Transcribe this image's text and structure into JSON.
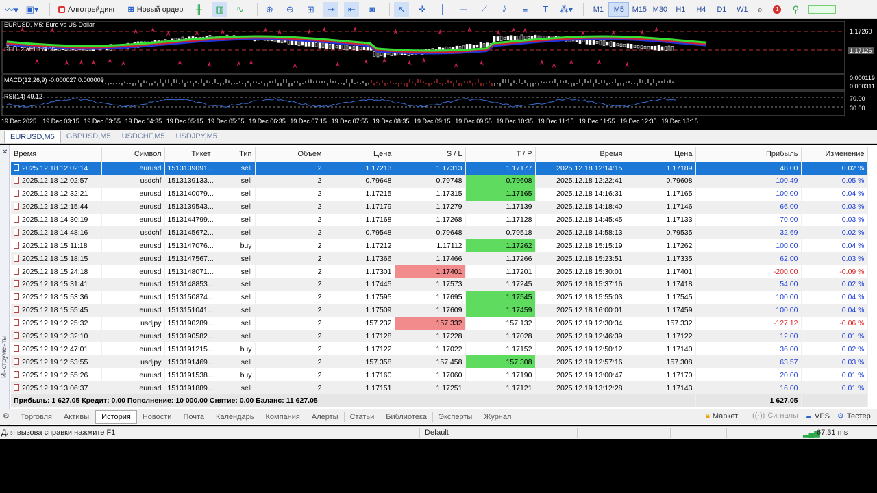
{
  "toolbar": {
    "algo_label": "Алготрейдинг",
    "new_order_label": "Новый ордер",
    "timeframes": [
      "M1",
      "M5",
      "M15",
      "M30",
      "H1",
      "H4",
      "D1",
      "W1"
    ],
    "active_timeframe": "M5",
    "notification_count": "1"
  },
  "chart": {
    "title": "EURUSD, M5:  Euro vs US Dollar",
    "sell_label": "SELL 2 at 1.17106",
    "price_top": "1.17260",
    "price_cur": "1.17126",
    "macd_label": "MACD(12,26,9) -0.000027 0.000009",
    "macd_v1": "0.000119",
    "macd_v2": "0.000311",
    "rsi_label": "RSI(14) 49.12",
    "rsi_v1": "70.00",
    "rsi_v2": "30.00",
    "time_labels": [
      "19 Dec 2025",
      "19 Dec 03:15",
      "19 Dec 03:55",
      "19 Dec 04:35",
      "19 Dec 05:15",
      "19 Dec 05:55",
      "19 Dec 06:35",
      "19 Dec 07:15",
      "19 Dec 07:55",
      "19 Dec 08:35",
      "19 Dec 09:15",
      "19 Dec 09:55",
      "19 Dec 10:35",
      "19 Dec 11:15",
      "19 Dec 11:55",
      "19 Dec 12:35",
      "19 Dec 13:15"
    ]
  },
  "chart_tabs": [
    "EURUSD,M5",
    "GBPUSD,M5",
    "USDCHF,M5",
    "USDJPY,M5"
  ],
  "terminal": {
    "side_label": "Инструменты",
    "columns": [
      "Время",
      "Символ",
      "Тикет",
      "Тип",
      "Объем",
      "Цена",
      "S / L",
      "T / P",
      "Время",
      "Цена",
      "Прибыль",
      "Изменение"
    ],
    "rows": [
      [
        "2025.12.18 12:02:14",
        "eurusd",
        "1513139091...",
        "sell",
        "2",
        "1.17213",
        "1.17313",
        "1.17177",
        "2025.12.18 12:14:15",
        "1.17189",
        "48.00",
        "0.02 %"
      ],
      [
        "2025.12.18 12:02:57",
        "usdchf",
        "1513139133...",
        "sell",
        "2",
        "0.79648",
        "0.79748",
        "0.79608",
        "2025.12.18 12:22:41",
        "0.79608",
        "100.49",
        "0.05 %"
      ],
      [
        "2025.12.18 12:32:21",
        "eurusd",
        "1513140079...",
        "sell",
        "2",
        "1.17215",
        "1.17315",
        "1.17165",
        "2025.12.18 14:16:31",
        "1.17165",
        "100.00",
        "0.04 %"
      ],
      [
        "2025.12.18 12:15:44",
        "eurusd",
        "1513139543...",
        "sell",
        "2",
        "1.17179",
        "1.17279",
        "1.17139",
        "2025.12.18 14:18:40",
        "1.17146",
        "66.00",
        "0.03 %"
      ],
      [
        "2025.12.18 14:30:19",
        "eurusd",
        "1513144799...",
        "sell",
        "2",
        "1.17168",
        "1.17268",
        "1.17128",
        "2025.12.18 14:45:45",
        "1.17133",
        "70.00",
        "0.03 %"
      ],
      [
        "2025.12.18 14:48:16",
        "usdchf",
        "1513145672...",
        "sell",
        "2",
        "0.79548",
        "0.79648",
        "0.79518",
        "2025.12.18 14:58:13",
        "0.79535",
        "32.69",
        "0.02 %"
      ],
      [
        "2025.12.18 15:11:18",
        "eurusd",
        "1513147076...",
        "buy",
        "2",
        "1.17212",
        "1.17112",
        "1.17262",
        "2025.12.18 15:15:19",
        "1.17262",
        "100.00",
        "0.04 %"
      ],
      [
        "2025.12.18 15:18:15",
        "eurusd",
        "1513147567...",
        "sell",
        "2",
        "1.17366",
        "1.17466",
        "1.17266",
        "2025.12.18 15:23:51",
        "1.17335",
        "62.00",
        "0.03 %"
      ],
      [
        "2025.12.18 15:24:18",
        "eurusd",
        "1513148071...",
        "sell",
        "2",
        "1.17301",
        "1.17401",
        "1.17201",
        "2025.12.18 15:30:01",
        "1.17401",
        "-200.00",
        "-0.09 %"
      ],
      [
        "2025.12.18 15:31:41",
        "eurusd",
        "1513148853...",
        "sell",
        "2",
        "1.17445",
        "1.17573",
        "1.17245",
        "2025.12.18 15:37:16",
        "1.17418",
        "54.00",
        "0.02 %"
      ],
      [
        "2025.12.18 15:53:36",
        "eurusd",
        "1513150874...",
        "sell",
        "2",
        "1.17595",
        "1.17695",
        "1.17545",
        "2025.12.18 15:55:03",
        "1.17545",
        "100.00",
        "0.04 %"
      ],
      [
        "2025.12.18 15:55:45",
        "eurusd",
        "1513151041...",
        "sell",
        "2",
        "1.17509",
        "1.17609",
        "1.17459",
        "2025.12.18 16:00:01",
        "1.17459",
        "100.00",
        "0.04 %"
      ],
      [
        "2025.12.19 12:25:32",
        "usdjpy",
        "1513190289...",
        "sell",
        "2",
        "157.232",
        "157.332",
        "157.132",
        "2025.12.19 12:30:34",
        "157.332",
        "-127.12",
        "-0.06 %"
      ],
      [
        "2025.12.19 12:32:10",
        "eurusd",
        "1513190582...",
        "sell",
        "2",
        "1.17128",
        "1.17228",
        "1.17028",
        "2025.12.19 12:46:39",
        "1.17122",
        "12.00",
        "0.01 %"
      ],
      [
        "2025.12.19 12:47:01",
        "eurusd",
        "1513191215...",
        "buy",
        "2",
        "1.17122",
        "1.17022",
        "1.17152",
        "2025.12.19 12:50:12",
        "1.17140",
        "36.00",
        "0.02 %"
      ],
      [
        "2025.12.19 12:53:55",
        "usdjpy",
        "1513191469...",
        "sell",
        "2",
        "157.358",
        "157.458",
        "157.308",
        "2025.12.19 12:57:16",
        "157.308",
        "63.57",
        "0.03 %"
      ],
      [
        "2025.12.19 12:55:26",
        "eurusd",
        "1513191538...",
        "buy",
        "2",
        "1.17160",
        "1.17060",
        "1.17190",
        "2025.12.19 13:00:47",
        "1.17170",
        "20.00",
        "0.01 %"
      ],
      [
        "2025.12.19 13:06:37",
        "eurusd",
        "1513191889...",
        "sell",
        "2",
        "1.17151",
        "1.17251",
        "1.17121",
        "2025.12.19 13:12:28",
        "1.17143",
        "16.00",
        "0.01 %"
      ]
    ],
    "sl_hit_rows": [
      8,
      12
    ],
    "tp_hit_rows": [
      1,
      2,
      6,
      10,
      11,
      15
    ],
    "summary": "Прибыль: 1 627.05  Кредит: 0.00  Пополнение: 10 000.00  Снятие: 0.00  Баланс: 11 627.05",
    "summary_total": "1 627.05"
  },
  "bottom_tabs": [
    "Торговля",
    "Активы",
    "История",
    "Новости",
    "Почта",
    "Календарь",
    "Компания",
    "Алерты",
    "Статьи",
    "Библиотека",
    "Эксперты",
    "Журнал"
  ],
  "active_bottom_tab": "История",
  "bottom_right": {
    "market": "Маркет",
    "signals": "Сигналы",
    "vps": "VPS",
    "tester": "Тестер"
  },
  "status": {
    "help": "Для вызова справки нажмите F1",
    "profile": "Default",
    "ping": "67.31 ms"
  },
  "colors": {
    "selected_row": "#1c78d7",
    "sl_hit": "#f28c8c",
    "tp_hit": "#5fdb5f",
    "profit_positive": "#1f3fd6",
    "profit_negative": "#e02424"
  }
}
